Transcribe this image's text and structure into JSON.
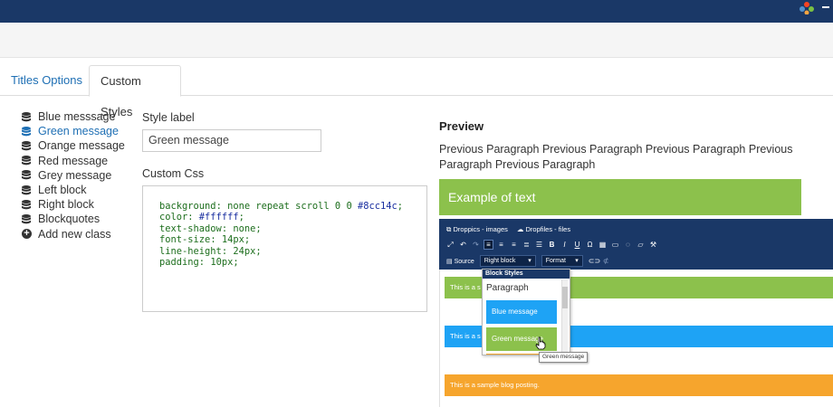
{
  "tabs": {
    "titles_options": "Titles Options",
    "custom_styles": "Custom Styles"
  },
  "classes": [
    {
      "label": "Blue messsage",
      "icon": "database-icon",
      "active": false
    },
    {
      "label": "Green message",
      "icon": "database-icon",
      "active": true
    },
    {
      "label": "Orange message",
      "icon": "database-icon",
      "active": false
    },
    {
      "label": "Red message",
      "icon": "database-icon",
      "active": false
    },
    {
      "label": "Grey message",
      "icon": "database-icon",
      "active": false
    },
    {
      "label": "Left block",
      "icon": "database-icon",
      "active": false
    },
    {
      "label": "Right block",
      "icon": "database-icon",
      "active": false
    },
    {
      "label": "Blockquotes",
      "icon": "database-icon",
      "active": false
    },
    {
      "label": "Add new class",
      "icon": "plus-circle-icon",
      "active": false
    }
  ],
  "form": {
    "style_label_heading": "Style label",
    "style_label_value": "Green message",
    "custom_css_heading": "Custom Css",
    "css_lines": [
      {
        "prop": "background",
        "value": "none repeat scroll 0 0",
        "hex": "#8cc14c"
      },
      {
        "prop": "color",
        "value": "",
        "hex": "#ffffff"
      },
      {
        "prop": "text-shadow",
        "value": "none",
        "hex": ""
      },
      {
        "prop": "font-size",
        "value": "14px",
        "hex": ""
      },
      {
        "prop": "line-height",
        "value": "24px",
        "hex": ""
      },
      {
        "prop": "padding",
        "value": "10px",
        "hex": ""
      }
    ]
  },
  "preview": {
    "title": "Preview",
    "text": "Previous Paragraph Previous Paragraph Previous Paragraph Previous Paragraph Previous Paragraph",
    "example": "Example of text"
  },
  "editor": {
    "toolbar_links": [
      "Droppics - images",
      "Dropfiles - files"
    ],
    "source_label": "Source",
    "block_dropdown": "Right block",
    "format_dropdown": "Format",
    "sample_green": "This is a s",
    "sample_blue": "This is a s",
    "sample_orange": "This is a sample blog posting.",
    "menu_heading": "Block Styles",
    "menu_paragraph": "Paragraph",
    "menu_blue": "Blue message",
    "menu_green": "Green message",
    "tooltip": "Green message"
  },
  "colors": {
    "topbar": "#1a3867",
    "link": "#1e6fb4",
    "green": "#8cc14c",
    "blue": "#1ea3f5",
    "orange": "#f6a52d"
  }
}
